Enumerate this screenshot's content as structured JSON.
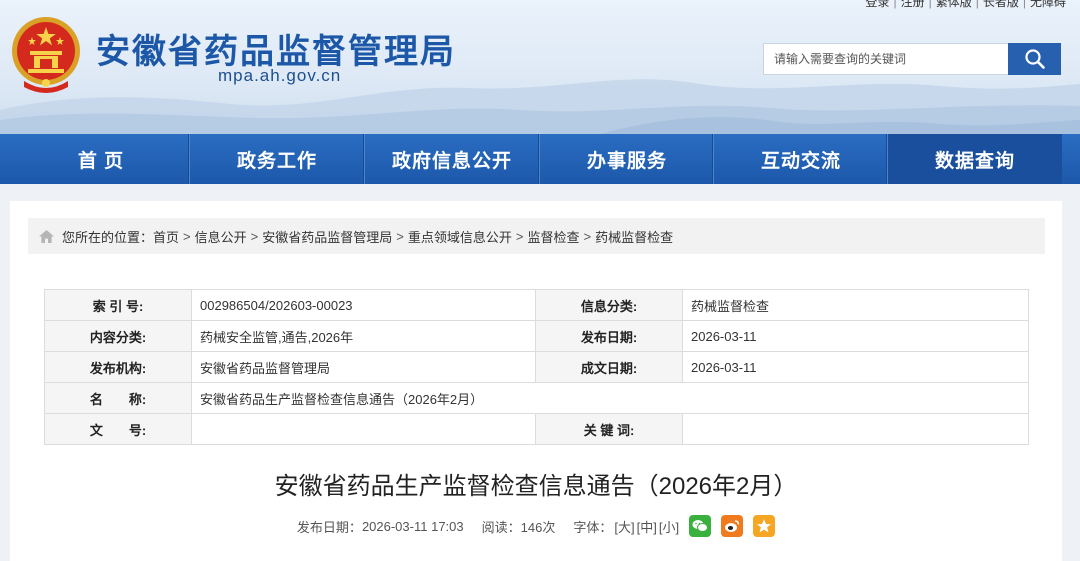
{
  "top_links": [
    "登录",
    "注册",
    "繁体版",
    "长者版",
    "无障碍"
  ],
  "site": {
    "title": "安徽省药品监督管理局",
    "domain": "mpa.ah.gov.cn"
  },
  "search": {
    "placeholder": "请输入需要查询的关键词",
    "button_icon": "search-icon"
  },
  "nav": {
    "items": [
      "首 页",
      "政务工作",
      "政府信息公开",
      "办事服务",
      "互动交流",
      "数据查询"
    ],
    "active_index": 5
  },
  "breadcrumb": {
    "icon": "home-icon",
    "prefix": "您所在的位置：",
    "items": [
      "首页",
      "信息公开",
      "安徽省药品监督管理局",
      "重点领域信息公开",
      "监督检查",
      "药械监督检查"
    ],
    "separator": ">"
  },
  "info": {
    "index_label": "索 引 号:",
    "index_value": "002986504/202603-00023",
    "category_label": "信息分类:",
    "category_value": "药械监督检查",
    "content_class_label": "内容分类:",
    "content_class_value": "药械安全监管,通告,2026年",
    "publish_date_label": "发布日期:",
    "publish_date_value": "2026-03-11",
    "org_label": "发布机构:",
    "org_value": "安徽省药品监督管理局",
    "written_date_label": "成文日期:",
    "written_date_value": "2026-03-11",
    "name_label": "名　　称:",
    "name_value": "安徽省药品生产监督检查信息通告（2026年2月）",
    "docno_label": "文　　号:",
    "docno_value": "",
    "keywords_label": "关 键 词:",
    "keywords_value": ""
  },
  "article": {
    "title": "安徽省药品生产监督检查信息通告（2026年2月）",
    "publish_label": "发布日期：",
    "publish_datetime": "2026-03-11 17:03",
    "read_label": "阅读：",
    "read_count": "146次",
    "font_label": "字体：",
    "font_large": "[大]",
    "font_medium": "[中]",
    "font_small": "[小]",
    "share_icons": [
      "wechat-icon",
      "weibo-icon",
      "favorite-icon"
    ]
  },
  "colors": {
    "brand_blue": "#1d58a8",
    "nav_blue": "#2160b4",
    "wechat_green": "#3ab03e",
    "weibo_orange": "#f07a1e",
    "star_orange": "#f5a623"
  }
}
